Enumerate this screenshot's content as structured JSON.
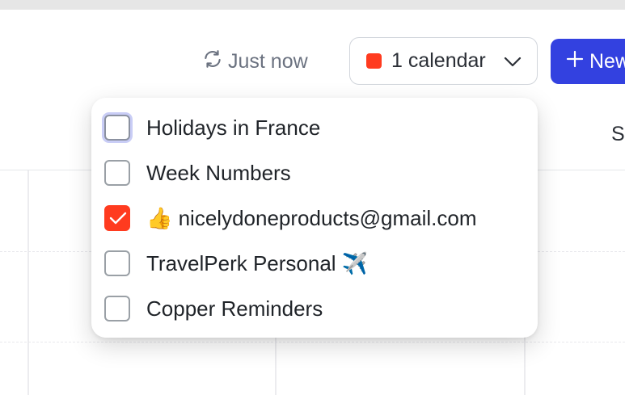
{
  "toolbar": {
    "sync_label": "Just now",
    "calendar_selector_label": "1 calendar",
    "new_button_label": "New"
  },
  "header": {
    "day_label_partial": "S"
  },
  "calendar_dropdown": {
    "items": [
      {
        "label": "Holidays in France",
        "checked": false
      },
      {
        "label": "Week Numbers",
        "checked": false
      },
      {
        "label": "👍 nicelydoneproducts@gmail.com",
        "checked": true
      },
      {
        "label": "TravelPerk Personal ✈️",
        "checked": false
      },
      {
        "label": "Copper Reminders",
        "checked": false
      }
    ]
  },
  "colors": {
    "accent_blue": "#3341e0",
    "calendar_red": "#ff3b1f",
    "muted_text": "#6b7280"
  }
}
